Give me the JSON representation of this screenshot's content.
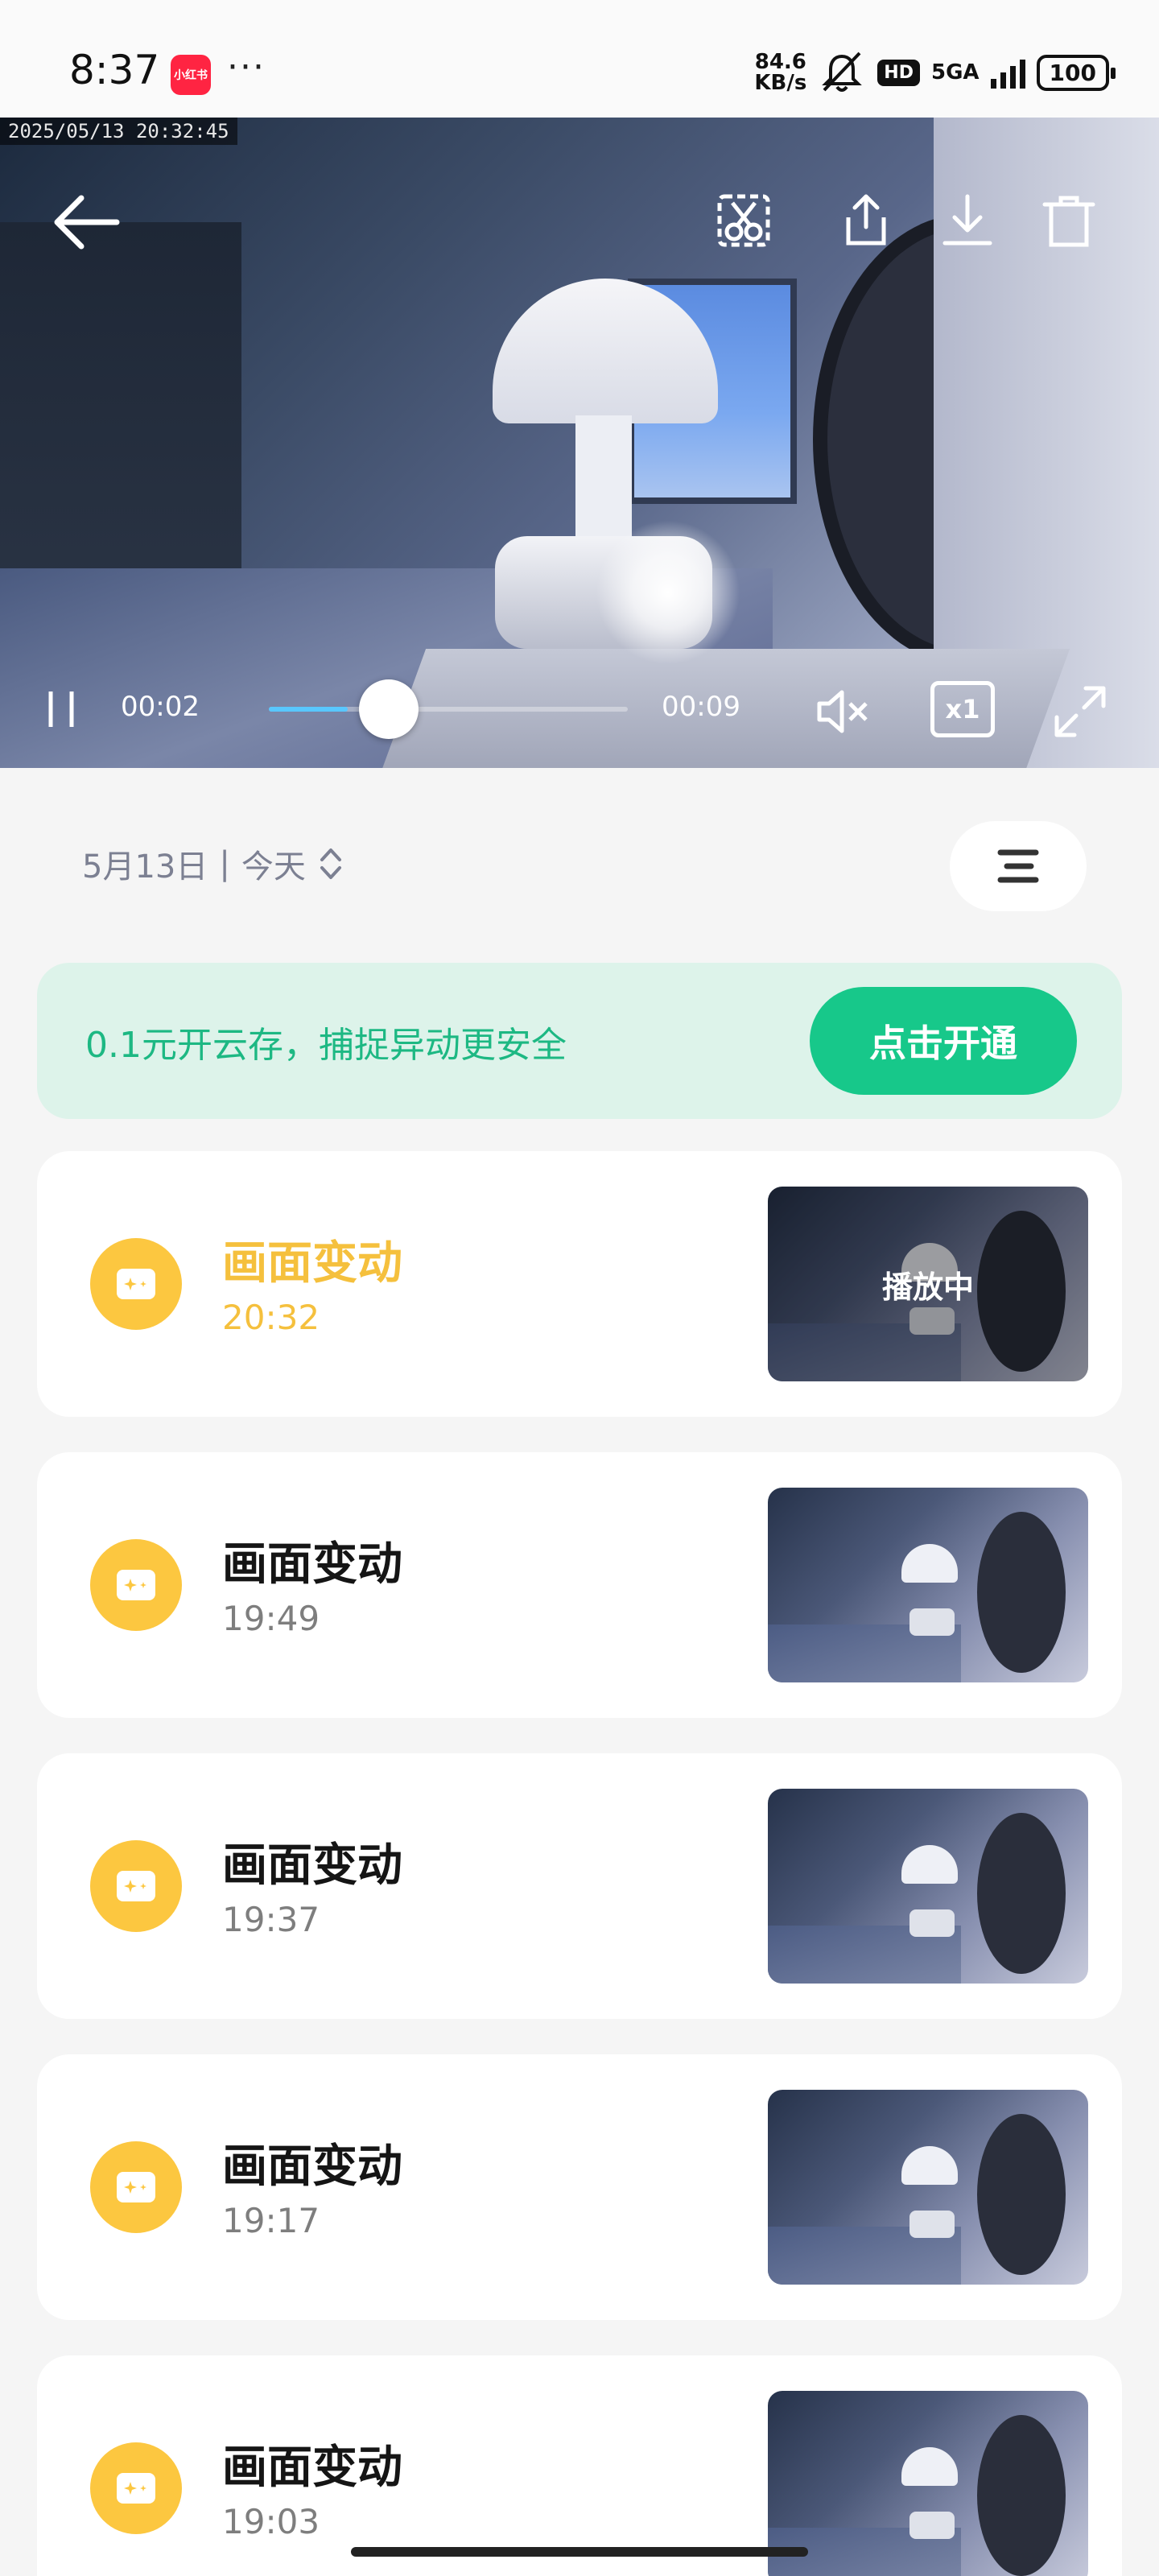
{
  "status_bar": {
    "time": "8:37",
    "app_badge": "小红书",
    "more": "···",
    "net_speed_value": "84.6",
    "net_speed_unit": "KB/s",
    "hd": "HD",
    "network": "5GA",
    "battery": "100"
  },
  "video": {
    "timestamp": "2025/05/13 20:32:45",
    "current_time": "00:02",
    "duration": "00:09",
    "progress_fraction": 0.22,
    "speed_label": "x1",
    "icons": [
      "back-icon",
      "scissors-icon",
      "share-icon",
      "download-icon",
      "delete-icon",
      "pause-icon",
      "mute-icon",
      "speed-icon",
      "fullscreen-icon"
    ]
  },
  "date_filter": {
    "date": "5月13日",
    "separator": "|",
    "day": "今天"
  },
  "promo": {
    "text": "0.1元开云存，捕捉异动更安全",
    "button": "点击开通",
    "accent_color": "#17c88a"
  },
  "events": [
    {
      "title": "画面变动",
      "time": "20:32",
      "thumb_label": "播放中",
      "active": true
    },
    {
      "title": "画面变动",
      "time": "19:49",
      "thumb_label": "",
      "active": false
    },
    {
      "title": "画面变动",
      "time": "19:37",
      "thumb_label": "",
      "active": false
    },
    {
      "title": "画面变动",
      "time": "19:17",
      "thumb_label": "",
      "active": false
    },
    {
      "title": "画面变动",
      "time": "19:03",
      "thumb_label": "",
      "active": false
    }
  ],
  "colors": {
    "event_icon": "#fcc740",
    "active_text": "#f5c03d"
  }
}
